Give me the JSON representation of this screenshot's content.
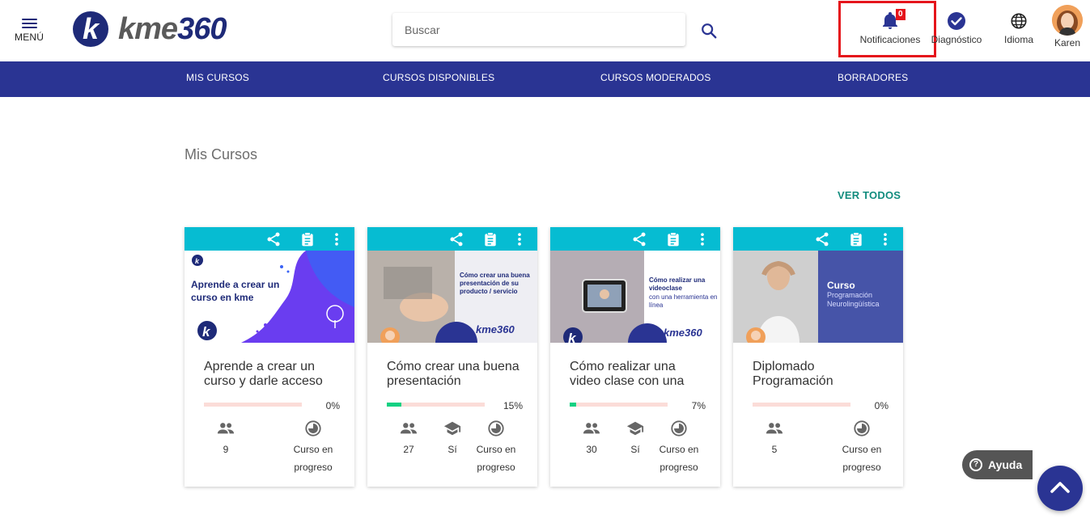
{
  "header": {
    "menu_label": "MENÚ",
    "logo_text": "kme",
    "logo_num": "360",
    "search_placeholder": "Buscar",
    "notifications_label": "Notificaciones",
    "notifications_count": "0",
    "diagnostic_label": "Diagnóstico",
    "language_label": "Idioma",
    "user_label": "Karen"
  },
  "nav": {
    "items": [
      {
        "label": "MIS CURSOS"
      },
      {
        "label": "CURSOS DISPONIBLES"
      },
      {
        "label": "CURSOS MODERADOS"
      },
      {
        "label": "BORRADORES"
      }
    ]
  },
  "main": {
    "section_title": "Mis Cursos",
    "see_all": "VER TODOS",
    "cards": [
      {
        "title": "Aprende a crear un curso y darle acceso",
        "progress_pct": 0,
        "progress_label": "0%",
        "students": "9",
        "certificate": "",
        "status_line1": "Curso en",
        "status_line2": "progreso",
        "image_text": "Aprende a crear un curso en kme",
        "image_small": "",
        "image_sub": ""
      },
      {
        "title": "Cómo crear una buena presentación",
        "progress_pct": 15,
        "progress_label": "15%",
        "students": "27",
        "certificate": "Sí",
        "status_line1": "Curso en",
        "status_line2": "progreso",
        "image_text": "Cómo crear una buena presentación de su producto / servicio",
        "image_small": "kme360",
        "image_sub": ""
      },
      {
        "title": "Cómo realizar una video clase con una",
        "progress_pct": 7,
        "progress_label": "7%",
        "students": "30",
        "certificate": "Sí",
        "status_line1": "Curso en",
        "status_line2": "progreso",
        "image_text": "Cómo realizar una videoclase",
        "image_small": "kme360",
        "image_sub": "con una herramienta en línea"
      },
      {
        "title": "Diplomado Programación",
        "progress_pct": 0,
        "progress_label": "0%",
        "students": "5",
        "certificate": "",
        "status_line1": "Curso en",
        "status_line2": "progreso",
        "image_text": "Curso",
        "image_small": "",
        "image_sub": "Programación Neurolingüística"
      }
    ]
  },
  "help": {
    "label": "Ayuda"
  },
  "colors": {
    "brand_navy": "#2a3493",
    "card_bar": "#06bcd2",
    "progress_fill": "#14d182",
    "progress_track": "#fbdcd8",
    "link_green": "#128c7e",
    "highlight_red": "#e5141b"
  }
}
